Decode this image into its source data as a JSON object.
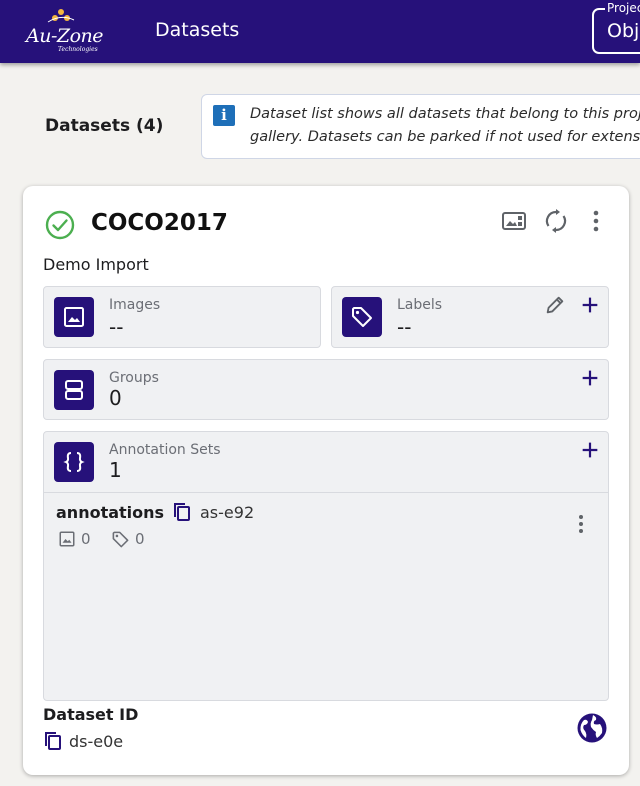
{
  "header": {
    "logo_text": "Au-Zone",
    "logo_subtext": "Technologies",
    "nav_title": "Datasets",
    "project_label": "Project",
    "project_value": "Obj"
  },
  "page": {
    "datasets_heading": "Datasets (4)",
    "info_text": "Dataset list shows all datasets that belong to this project gallery. Datasets can be parked if not used for extensive"
  },
  "card": {
    "title": "COCO2017",
    "subtitle": "Demo Import",
    "status": "ok",
    "tiles": {
      "images": {
        "label": "Images",
        "value": "--"
      },
      "labels": {
        "label": "Labels",
        "value": "--"
      },
      "groups": {
        "label": "Groups",
        "value": "0"
      },
      "annotation_sets": {
        "label": "Annotation Sets",
        "value": "1"
      }
    },
    "annotation_set": {
      "name": "annotations",
      "id": "as-e92",
      "image_count": "0",
      "label_count": "0"
    },
    "dataset_id_label": "Dataset ID",
    "dataset_id": "ds-e0e"
  },
  "colors": {
    "brand": "#26117a",
    "success": "#4caf50",
    "info": "#1e6fb8"
  },
  "icons": [
    "image-icon",
    "tag-icon",
    "groups-icon",
    "braces-icon",
    "edit-icon",
    "plus-icon",
    "copy-icon",
    "more-vert-icon",
    "refresh-icon",
    "gallery-icon",
    "globe-icon",
    "check-circle-icon",
    "info-icon"
  ]
}
